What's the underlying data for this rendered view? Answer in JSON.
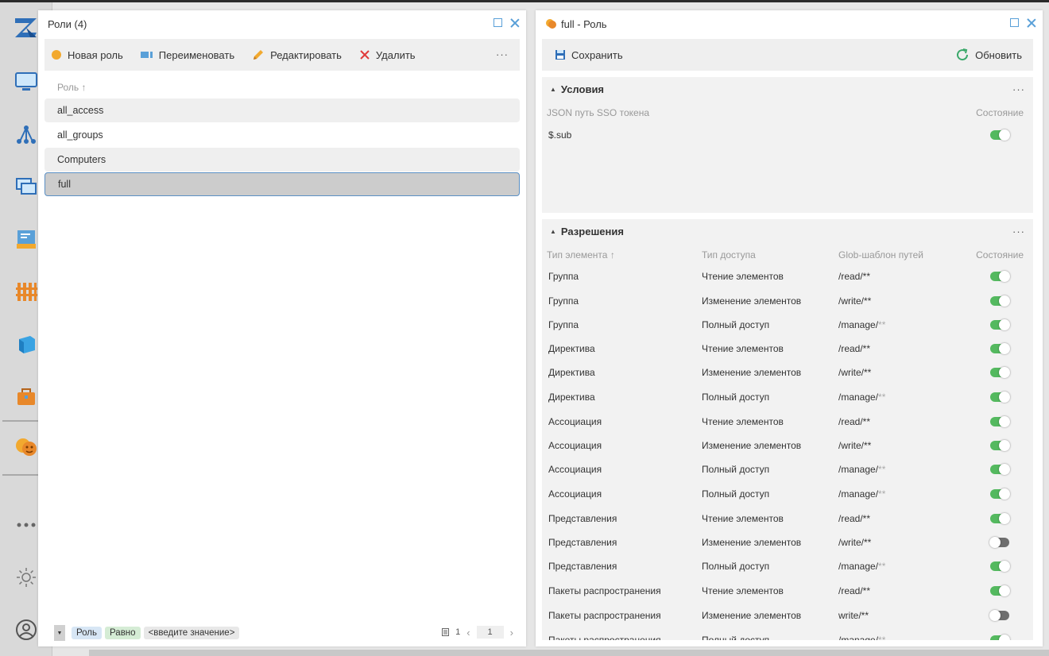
{
  "rail": {
    "items": [
      "logo",
      "monitor",
      "tree",
      "windows",
      "document",
      "fence",
      "cube",
      "bag",
      "masks",
      "more",
      "sun",
      "user"
    ]
  },
  "left_panel": {
    "title": "Роли (4)",
    "toolbar": {
      "new_role": "Новая роль",
      "rename": "Переименовать",
      "edit": "Редактировать",
      "delete": "Удалить",
      "more": "···"
    },
    "column_header": "Роль",
    "sort_indicator": "↑",
    "roles": [
      "all_access",
      "all_groups",
      "Computers",
      "full"
    ],
    "selected_role": "full",
    "footer": {
      "chip_field": "Роль",
      "chip_op": "Равно",
      "value_placeholder": "<введите значение>",
      "page_count": "1",
      "current_page": "1"
    }
  },
  "right_panel": {
    "title": "full - Роль",
    "toolbar": {
      "save": "Сохранить",
      "refresh": "Обновить"
    },
    "conditions": {
      "title": "Условия",
      "col_path": "JSON путь SSO токена",
      "col_state": "Состояние",
      "rows": [
        {
          "path": "$.sub",
          "enabled": true
        }
      ]
    },
    "permissions": {
      "title": "Разрешения",
      "col_type": "Тип элемента",
      "col_access": "Тип доступа",
      "col_glob": "Glob-шаблон путей",
      "col_state": "Состояние",
      "rows": [
        {
          "type": "Группа",
          "access": "Чтение элементов",
          "glob": "/read/**",
          "glob_dim": "",
          "enabled": true
        },
        {
          "type": "Группа",
          "access": "Изменение элементов",
          "glob": "/write/**",
          "glob_dim": "",
          "enabled": true
        },
        {
          "type": "Группа",
          "access": "Полный доступ",
          "glob": "/manage/",
          "glob_dim": "**",
          "enabled": true
        },
        {
          "type": "Директива",
          "access": "Чтение элементов",
          "glob": "/read/**",
          "glob_dim": "",
          "enabled": true
        },
        {
          "type": "Директива",
          "access": "Изменение элементов",
          "glob": "/write/**",
          "glob_dim": "",
          "enabled": true
        },
        {
          "type": "Директива",
          "access": "Полный доступ",
          "glob": "/manage/",
          "glob_dim": "**",
          "enabled": true
        },
        {
          "type": "Ассоциация",
          "access": "Чтение элементов",
          "glob": "/read/**",
          "glob_dim": "",
          "enabled": true
        },
        {
          "type": "Ассоциация",
          "access": "Изменение элементов",
          "glob": "/write/**",
          "glob_dim": "",
          "enabled": true
        },
        {
          "type": "Ассоциация",
          "access": "Полный доступ",
          "glob": "/manage/",
          "glob_dim": "**",
          "enabled": true
        },
        {
          "type": "Ассоциация",
          "access": "Полный доступ",
          "glob": "/manage/",
          "glob_dim": "**",
          "enabled": true
        },
        {
          "type": "Представления",
          "access": "Чтение элементов",
          "glob": "/read/**",
          "glob_dim": "",
          "enabled": true
        },
        {
          "type": "Представления",
          "access": "Изменение элементов",
          "glob": "/write/**",
          "glob_dim": "",
          "enabled": false
        },
        {
          "type": "Представления",
          "access": "Полный доступ",
          "glob": "/manage/",
          "glob_dim": "**",
          "enabled": true
        },
        {
          "type": "Пакеты распространения",
          "access": "Чтение элементов",
          "glob": "/read/**",
          "glob_dim": "",
          "enabled": true
        },
        {
          "type": "Пакеты распространения",
          "access": "Изменение элементов",
          "glob": "write/**",
          "glob_dim": "",
          "enabled": false
        },
        {
          "type": "Пакеты распространения",
          "access": "Полный доступ",
          "glob": "/manage/",
          "glob_dim": "**",
          "enabled": true
        }
      ]
    }
  },
  "colors": {
    "accent": "#5aa0d8",
    "toggle_on": "#54b95f",
    "toggle_off": "#6e6e6e",
    "selected": "#cccccc"
  }
}
